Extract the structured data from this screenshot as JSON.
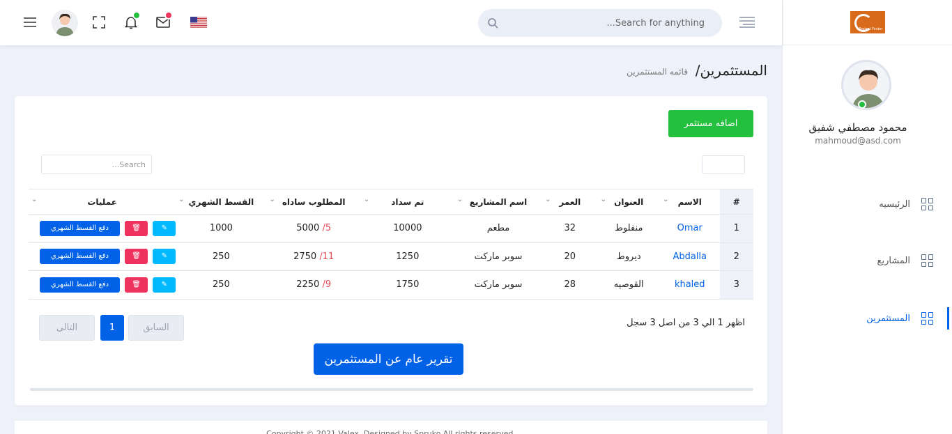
{
  "sidebar": {
    "logo_text": "Project Finder",
    "user_name": "محمود مصطفي شفيق",
    "user_email": "mahmoud@asd.com",
    "items": [
      {
        "label": "الرئيسيه",
        "icon": "grid-icon"
      },
      {
        "label": "المشاريع",
        "icon": "grid-icon"
      },
      {
        "label": "المستثمرين",
        "icon": "grid-icon",
        "active": true
      }
    ]
  },
  "header": {
    "search_placeholder": "Search for anything...",
    "language_icon": "us-flag-icon",
    "mail_icon": "mail-icon",
    "bell_icon": "bell-icon",
    "fullscreen_icon": "fullscreen-icon",
    "menu_icon": "hamburger-icon",
    "colors": {
      "bell_badge": "#22c03c",
      "mail_badge": "#ee335e"
    }
  },
  "page": {
    "title": "المستثمرين/",
    "breadcrumb": "قائمه المستثمرين"
  },
  "card": {
    "add_button": "اضافه مستثمر",
    "search_placeholder": "Search...",
    "columns": [
      "#",
      "الاسم",
      "العنوان",
      "العمر",
      "اسم المشاريع",
      "تم سداد",
      "المطلوب ساداه",
      "القسط الشهري",
      "عمليات"
    ],
    "rows": [
      {
        "n": "1",
        "name": "Omar",
        "address": "منفلوط",
        "age": "32",
        "project": "مطعم",
        "paid": "10000",
        "required": "5000",
        "required_count": "5/",
        "monthly": "1000"
      },
      {
        "n": "2",
        "name": "Abdalla",
        "address": "ديروط",
        "age": "20",
        "project": "سوبر ماركت",
        "paid": "1250",
        "required": "2750",
        "required_count": "11/",
        "monthly": "250"
      },
      {
        "n": "3",
        "name": "khaled",
        "address": "القوصيه",
        "age": "28",
        "project": "سوبر ماركت",
        "paid": "1750",
        "required": "2250",
        "required_count": "9/",
        "monthly": "250"
      }
    ],
    "pay_button": "دفع القسط الشهري",
    "info": "اظهر 1 الي 3 من اصل 3 سجل",
    "prev": "السابق",
    "page_num": "1",
    "next": "التالي",
    "report_button": "تقرير عام عن المستثمرين"
  },
  "footer": {
    "text": "Copyright © 2021 Valex. Designed by Spruko All rights reserved."
  },
  "colors": {
    "primary": "#0162e8",
    "success": "#22c03c",
    "danger": "#ee335e",
    "info": "#00b9ff"
  }
}
